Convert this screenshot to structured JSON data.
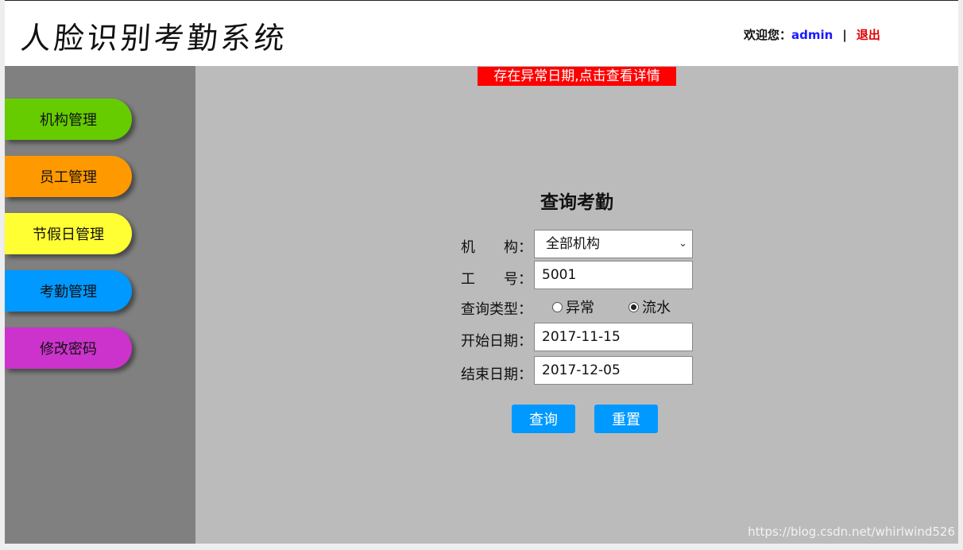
{
  "header": {
    "title": "人脸识别考勤系统",
    "welcome_label": "欢迎您：",
    "username": "admin",
    "separator": "|",
    "logout_label": "退出"
  },
  "sidebar": {
    "items": [
      {
        "label": "机构管理",
        "color": "#66cc00"
      },
      {
        "label": "员工管理",
        "color": "#ff9900"
      },
      {
        "label": "节假日管理",
        "color": "#ffff33"
      },
      {
        "label": "考勤管理",
        "color": "#0099ff"
      },
      {
        "label": "修改密码",
        "color": "#cc33cc"
      }
    ]
  },
  "main": {
    "alert": "存在异常日期,点击查看详情",
    "form": {
      "title": "查询考勤",
      "org_label": "机　　构：",
      "org_value": "全部机构",
      "empno_label": "工　　号：",
      "empno_value": "5001",
      "type_label": "查询类型：",
      "type_options": [
        "异常",
        "流水"
      ],
      "type_selected": "流水",
      "start_label": "开始日期：",
      "start_value": "2017-11-15",
      "end_label": "结束日期：",
      "end_value": "2017-12-05",
      "query_button": "查询",
      "reset_button": "重置"
    }
  },
  "watermark": "https://blog.csdn.net/whirlwind526",
  "colors": {
    "sidebar_bg": "#808080",
    "main_bg": "#bbbbbb",
    "alert_bg": "#ff0000",
    "button_bg": "#0099ff",
    "username": "#1a1aff",
    "logout": "#e00000"
  }
}
